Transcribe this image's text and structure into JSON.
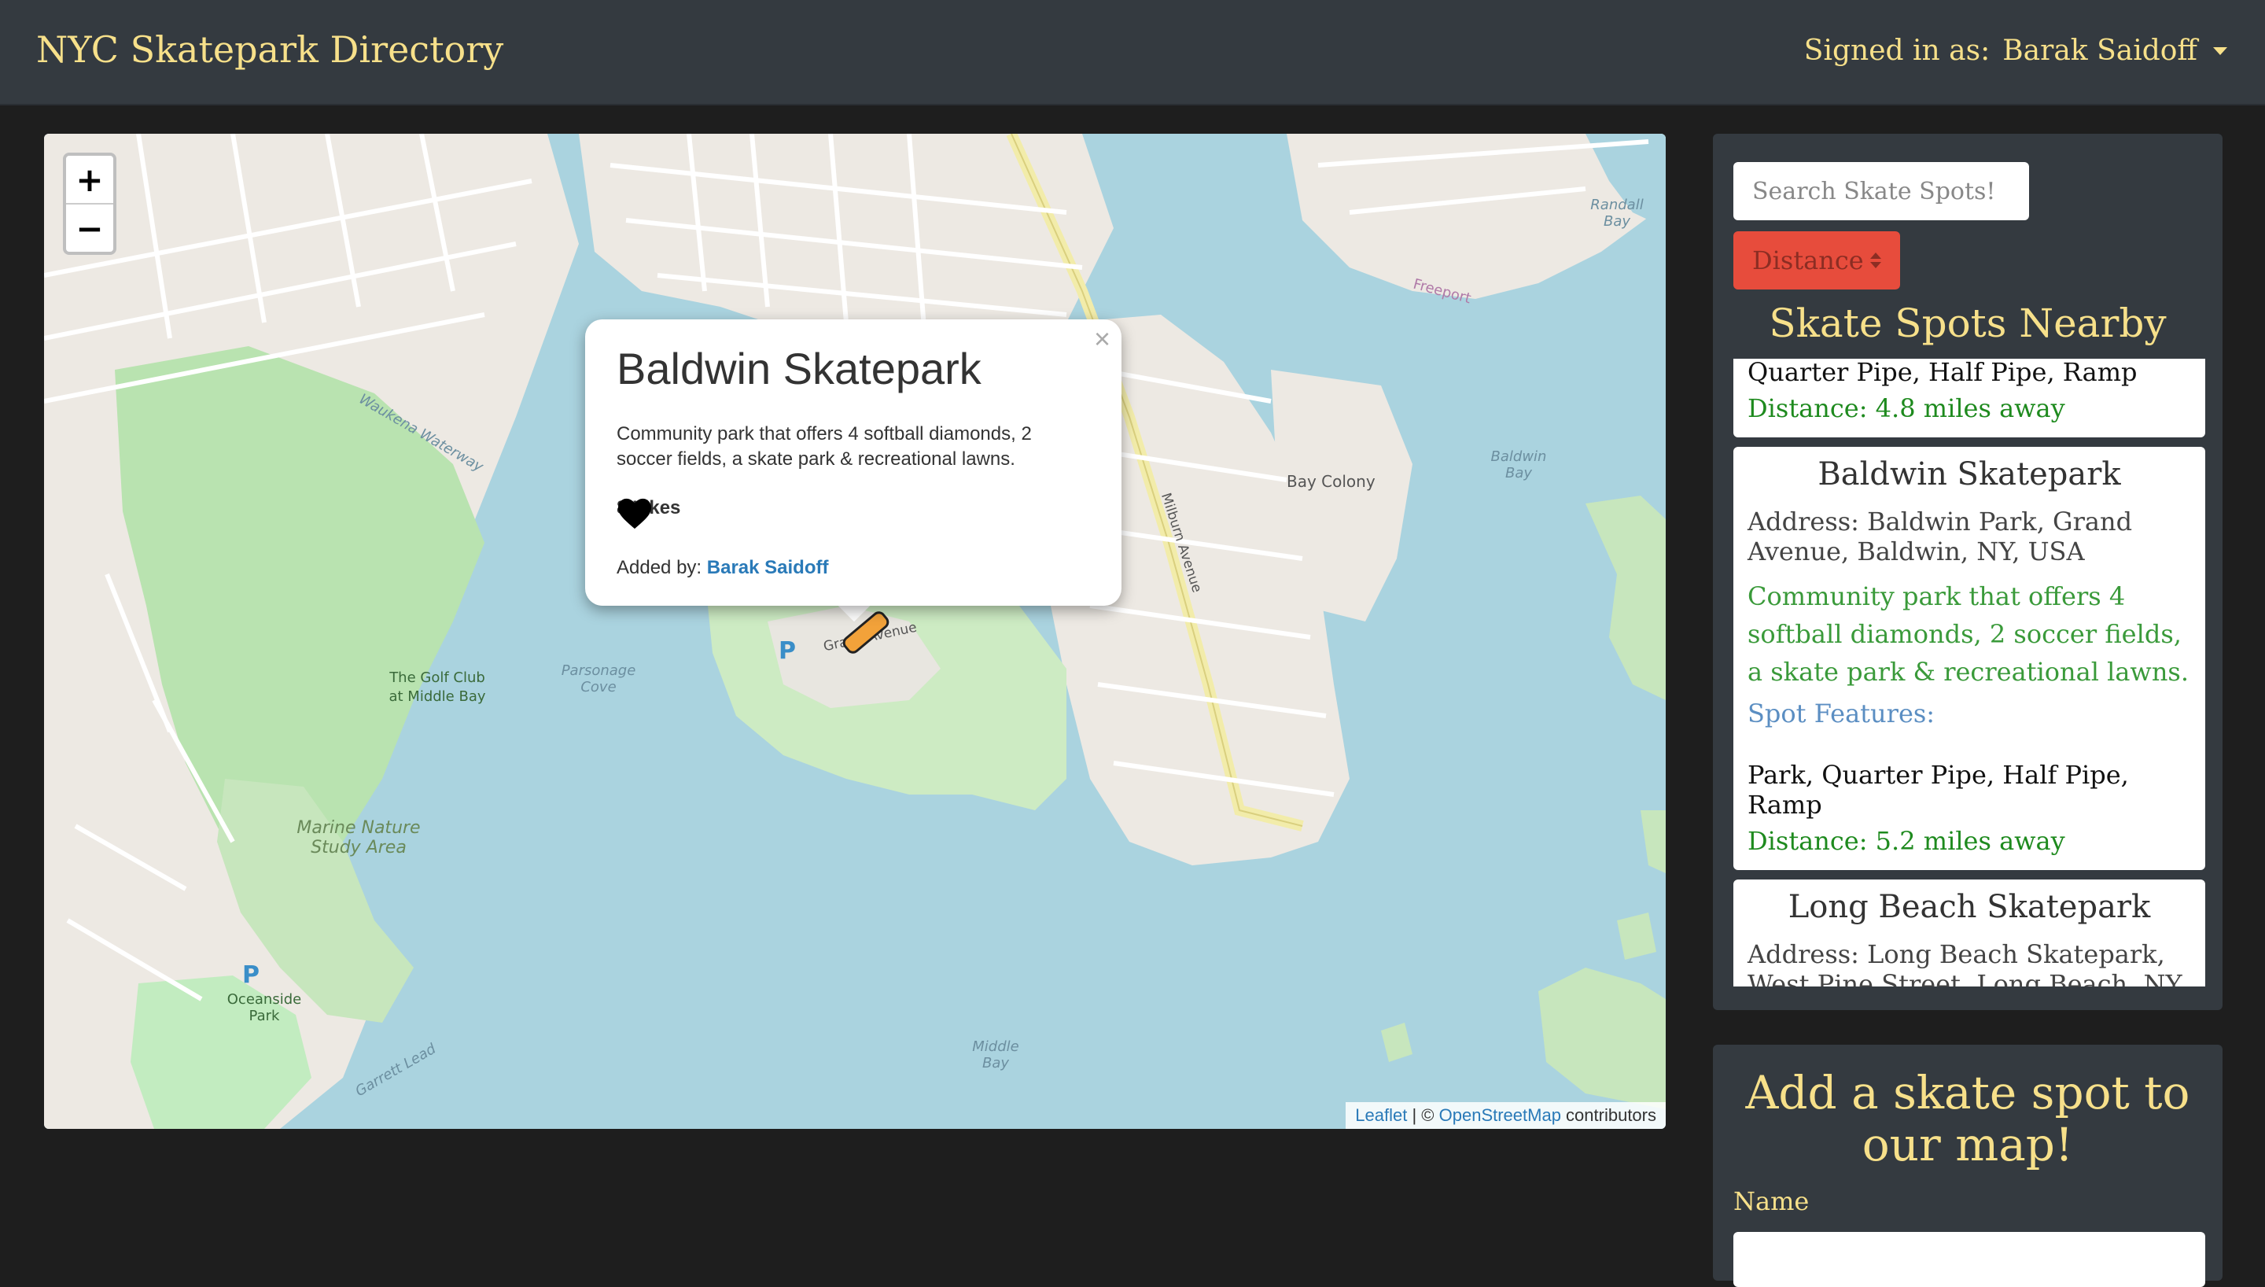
{
  "navbar": {
    "brand": "NYC Skatepark Directory",
    "signed_in_label": "Signed in as:",
    "user_name": "Barak Saidoff"
  },
  "map": {
    "zoom_in": "+",
    "zoom_out": "−",
    "labels": {
      "golf_club": "The Golf Club at Middle Bay",
      "parsonage_cove": "Parsonage Cove",
      "marine_nature": "Marine Nature Study Area",
      "oceanside_park": "Oceanside Park",
      "middle_bay": "Middle Bay",
      "baldwin_bay": "Baldwin Bay",
      "bay_colony": "Bay Colony",
      "garrett_lead": "Garrett Lead",
      "waukena_waterway": "Waukena Waterway",
      "randall_bay": "Randall Bay",
      "freeport": "Freeport",
      "grand_avenue": "Grand Avenue",
      "milburn_avenue": "Milburn Avenue"
    },
    "popup": {
      "close": "×",
      "title": "Baldwin Skatepark",
      "description": "Community park that offers 4 softball diamonds, 2 soccer fields, a skate park & recreational lawns.",
      "likes": "8 Likes",
      "added_by_label": "Added by:",
      "added_by_user": "Barak Saidoff"
    },
    "attribution": {
      "leaflet": "Leaflet",
      "separator": " | © ",
      "osm": "OpenStreetMap",
      "contributors": " contributors"
    }
  },
  "sidebar": {
    "search_placeholder": "Search Skate Spots!",
    "sort_label": "Distance",
    "nearby_title": "Skate Spots Nearby",
    "spots": [
      {
        "features": "Quarter Pipe, Half Pipe, Ramp",
        "distance": "Distance: 4.8 miles away"
      },
      {
        "name": "Baldwin Skatepark",
        "address": "Address: Baldwin Park, Grand Avenue, Baldwin, NY, USA",
        "description": "Community park that offers 4 softball diamonds, 2 soccer fields, a skate park & recreational lawns.",
        "features_label": "Spot Features:",
        "features": "Park, Quarter Pipe, Half Pipe, Ramp",
        "distance": "Distance: 5.2 miles away"
      },
      {
        "name": "Long Beach Skatepark",
        "address": "Address: Long Beach Skatepark, West Pine Street, Long Beach, NY"
      }
    ]
  },
  "add_spot": {
    "title": "Add a skate spot to our map!",
    "name_label": "Name"
  },
  "colors": {
    "accent": "#f7e08a",
    "panel": "#343a40",
    "water": "#aad3df",
    "sort_button": "#e74c3c"
  }
}
